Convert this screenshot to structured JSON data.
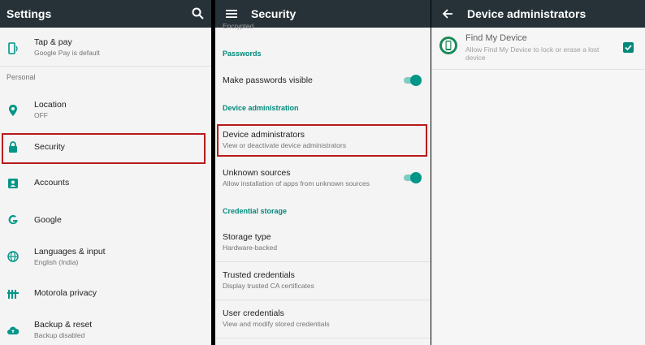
{
  "colors": {
    "appbar": "#263238",
    "accent": "#009688",
    "highlight": "#b71c1c"
  },
  "settings": {
    "title": "Settings",
    "search_icon": "search-icon",
    "items": [
      {
        "label": "Tap & pay",
        "sub": "Google Pay is default",
        "icon": "tap-pay-icon"
      },
      {
        "label": "Location",
        "sub": "OFF",
        "icon": "location-pin-icon"
      },
      {
        "label": "Security",
        "sub": "",
        "icon": "lock-icon"
      },
      {
        "label": "Accounts",
        "sub": "",
        "icon": "account-icon"
      },
      {
        "label": "Google",
        "sub": "",
        "icon": "google-icon"
      },
      {
        "label": "Languages & input",
        "sub": "English (India)",
        "icon": "globe-icon"
      },
      {
        "label": "Motorola privacy",
        "sub": "",
        "icon": "privacy-icon"
      },
      {
        "label": "Backup & reset",
        "sub": "Backup disabled",
        "icon": "cloud-upload-icon"
      }
    ],
    "section_personal": "Personal"
  },
  "security": {
    "title": "Security",
    "menu_icon": "hamburger-menu-icon",
    "cut_text": "Encrypted",
    "cat_passwords": "Passwords",
    "make_visible": "Make passwords visible",
    "cat_device_admin": "Device administration",
    "device_admins": {
      "label": "Device administrators",
      "sub": "View or deactivate device administrators"
    },
    "unknown_sources": {
      "label": "Unknown sources",
      "sub": "Allow installation of apps from unknown sources"
    },
    "cat_credential": "Credential storage",
    "storage_type": {
      "label": "Storage type",
      "sub": "Hardware-backed"
    },
    "trusted": {
      "label": "Trusted credentials",
      "sub": "Display trusted CA certificates"
    },
    "user_creds": {
      "label": "User credentials",
      "sub": "View and modify stored credentials"
    }
  },
  "device_admins": {
    "title": "Device administrators",
    "back_icon": "back-arrow-icon",
    "app": {
      "name": "Find My Device",
      "desc": "Allow Find My Device to lock or erase a lost device",
      "icon": "find-my-device-icon",
      "checked": true
    }
  }
}
